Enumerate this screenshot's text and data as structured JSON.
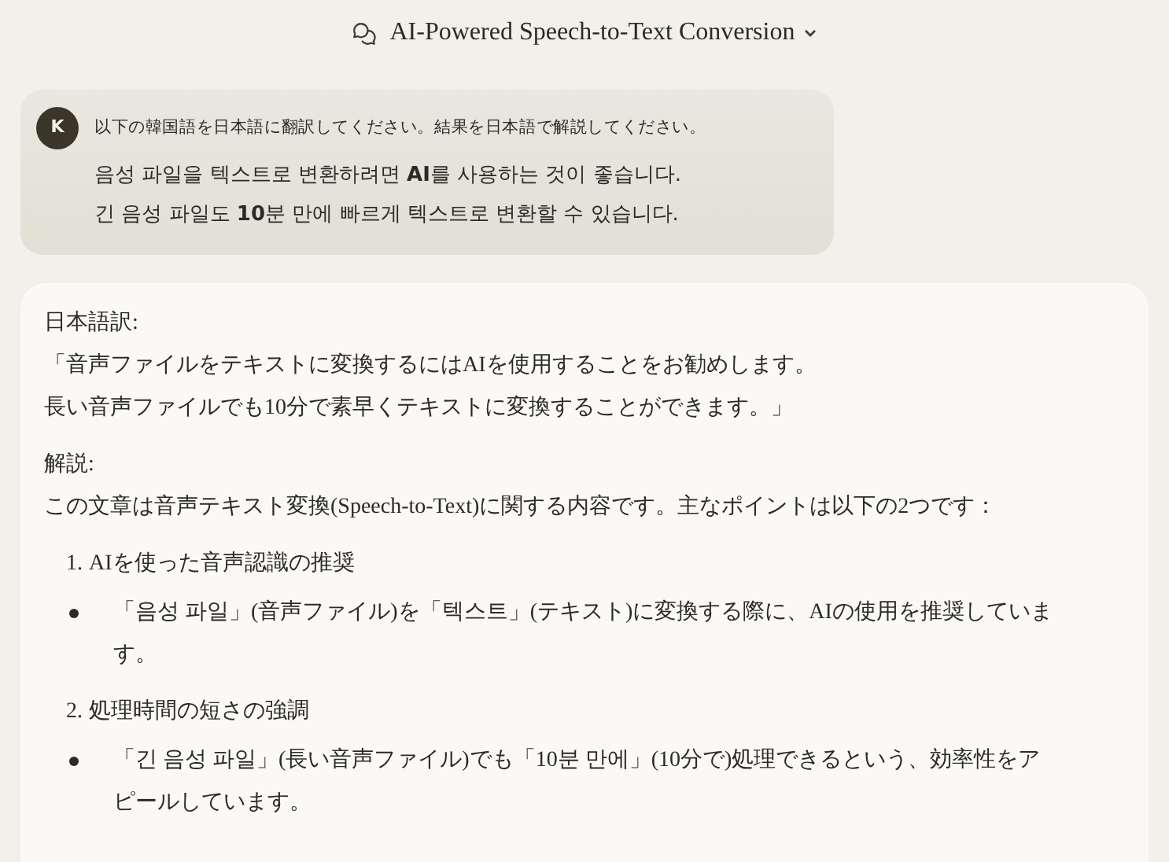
{
  "title": "AI-Powered Speech-to-Text Conversion",
  "user_message": {
    "avatar": "K",
    "instruction": "以下の韓国語を日本語に翻訳してください。結果を日本語で解説してください。",
    "lines": [
      "음성 파일을 텍스트로 변환하려면 **AI**를 사용하는 것이 좋습니다.",
      "긴 음성 파일도 **10**분 만에 빠르게 텍스트로 변환할 수 있습니다."
    ]
  },
  "response": [
    {
      "kind": "heading",
      "text": "日本語訳:"
    },
    {
      "kind": "line",
      "text": "「音声ファイルをテキストに変換するにはAIを使用することをお勧めします。"
    },
    {
      "kind": "line",
      "text": "長い音声ファイルでも10分で素早くテキストに変換することができます。」"
    },
    {
      "kind": "heading",
      "text": "解説:"
    },
    {
      "kind": "paragraph",
      "text": "この文章は音声テキスト変換(Speech-to-Text)に関する内容です。主なポイントは以下の2つです："
    },
    {
      "kind": "numbered",
      "number": "1.",
      "text": "AIを使った音声認識の推奨"
    },
    {
      "kind": "bullet",
      "text": "「음성 파일」(音声ファイル)を「텍스트」(テキスト)に変換する際に、AIの使用を推奨しています。"
    },
    {
      "kind": "numbered",
      "number": "2.",
      "text": "処理時間の短さの強調"
    },
    {
      "kind": "bullet",
      "text": "「긴 음성 파일」(長い音声ファイル)でも「10분 만에」(10分で)処理できるという、効率性をアピールしています。"
    }
  ]
}
